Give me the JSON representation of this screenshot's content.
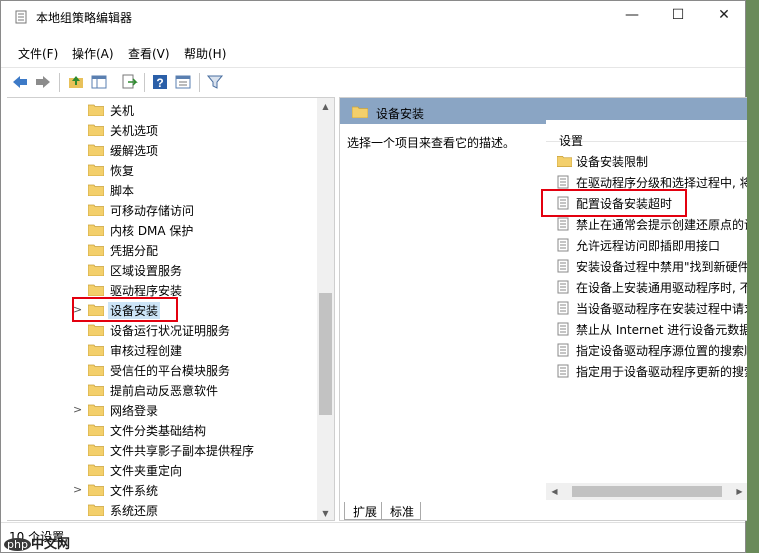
{
  "window": {
    "title": "本地组策略编辑器"
  },
  "menu": [
    "文件(F)",
    "操作(A)",
    "查看(V)",
    "帮助(H)"
  ],
  "tree": [
    {
      "label": "关机",
      "expander": ""
    },
    {
      "label": "关机选项",
      "expander": ""
    },
    {
      "label": "缓解选项",
      "expander": ""
    },
    {
      "label": "恢复",
      "expander": ""
    },
    {
      "label": "脚本",
      "expander": ""
    },
    {
      "label": "可移动存储访问",
      "expander": ""
    },
    {
      "label": "内核 DMA 保护",
      "expander": ""
    },
    {
      "label": "凭据分配",
      "expander": ""
    },
    {
      "label": "区域设置服务",
      "expander": ""
    },
    {
      "label": "驱动程序安装",
      "expander": ""
    },
    {
      "label": "设备安装",
      "expander": ">",
      "selected": true
    },
    {
      "label": "设备运行状况证明服务",
      "expander": ""
    },
    {
      "label": "审核过程创建",
      "expander": ""
    },
    {
      "label": "受信任的平台模块服务",
      "expander": ""
    },
    {
      "label": "提前启动反恶意软件",
      "expander": ""
    },
    {
      "label": "网络登录",
      "expander": ">"
    },
    {
      "label": "文件分类基础结构",
      "expander": ""
    },
    {
      "label": "文件共享影子副本提供程序",
      "expander": ""
    },
    {
      "label": "文件夹重定向",
      "expander": ""
    },
    {
      "label": "文件系统",
      "expander": ">"
    },
    {
      "label": "系统还原",
      "expander": ""
    }
  ],
  "right": {
    "header": "设备安装",
    "description": "选择一个项目来查看它的描述。",
    "column_header": "设置",
    "items": [
      {
        "label": "设备安装限制",
        "type": "folder"
      },
      {
        "label": "在驱动程序分级和选择过程中, 将",
        "type": "policy"
      },
      {
        "label": "配置设备安装超时",
        "type": "policy"
      },
      {
        "label": "禁止在通常会提示创建还原点的设",
        "type": "policy"
      },
      {
        "label": "允许远程访问即插即用接口",
        "type": "policy"
      },
      {
        "label": "安装设备过程中禁用\"找到新硬件",
        "type": "policy"
      },
      {
        "label": "在设备上安装通用驱动程序时, 不",
        "type": "policy"
      },
      {
        "label": "当设备驱动程序在安装过程中请求",
        "type": "policy"
      },
      {
        "label": "禁止从 Internet 进行设备元数据",
        "type": "policy"
      },
      {
        "label": "指定设备驱动程序源位置的搜索顺",
        "type": "policy"
      },
      {
        "label": "指定用于设备驱动程序更新的搜索",
        "type": "policy"
      }
    ],
    "tabs": [
      "扩展",
      "标准"
    ]
  },
  "status": "10 个设置",
  "watermark": {
    "logo": "php",
    "text": "中文网"
  },
  "colors": {
    "highlight": "#e3000f",
    "header_bg": "#8aa5c4",
    "selected_bg": "#cce4f7"
  }
}
